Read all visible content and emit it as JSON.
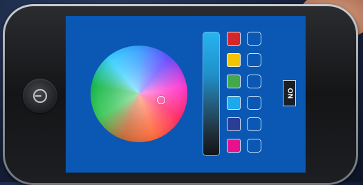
{
  "device": {
    "power_icon": "power-icon"
  },
  "color_picker": {
    "wheel_icon": "color-wheel",
    "brightness_level": 0.55
  },
  "swatches": [
    {
      "color": "#d4262b"
    },
    {
      "color": "#f5c400"
    },
    {
      "color": "#43a84a"
    },
    {
      "color": "#1ea8ee"
    },
    {
      "color": "#2a3f94"
    },
    {
      "color": "#e8108c"
    }
  ],
  "toggle": {
    "label": "ON"
  }
}
